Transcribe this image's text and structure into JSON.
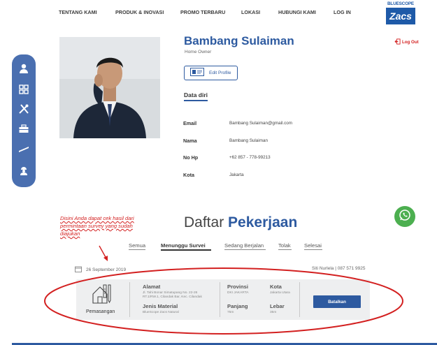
{
  "nav": {
    "items": [
      "TENTANG KAMI",
      "PRODUK & INOVASI",
      "PROMO TERBARU",
      "LOKASI",
      "HUBUNGI KAMI",
      "LOG IN"
    ]
  },
  "logo": {
    "top": "BLUESCOPE",
    "brand": "Zacs"
  },
  "sidebar": {
    "icons": [
      "user-icon",
      "grid-icon",
      "tools-icon",
      "toolbox-icon",
      "roof-icon",
      "worker-icon"
    ]
  },
  "profile": {
    "name": "Bambang Sulaiman",
    "role": "Home Owner",
    "edit_label": "Edit Profile",
    "logout_label": "Log Out",
    "section_title": "Data diri",
    "fields": [
      {
        "label": "Email",
        "value": "Bambang Sulaiman@gmail.com"
      },
      {
        "label": "Nama",
        "value": "Bambang Sulaiman"
      },
      {
        "label": "No Hp",
        "value": "+62 857 - 778-99213"
      },
      {
        "label": "Kota",
        "value": "Jakarta"
      }
    ]
  },
  "annotation": {
    "text": "Disini Anda dapat cek hasil dari permintaan survey yang sudah diajukan"
  },
  "jobs": {
    "title_plain": "Daftar",
    "title_bold": "Pekerjaan",
    "tabs": [
      {
        "label": "Semua",
        "active": false
      },
      {
        "label": "Menunggu Survei",
        "active": true
      },
      {
        "label": "Sedang Berjalan",
        "active": false
      },
      {
        "label": "Tolak",
        "active": false
      },
      {
        "label": "Selesai",
        "active": false
      }
    ],
    "date": "26 September 2019",
    "contact": "Siti Nurlela  |  087 571 9925",
    "card": {
      "category": "Pemasangan",
      "alamat_label": "Alamat",
      "alamat_value": "Jl. Tahi Bonar Simatupang No. 22-26 RT.1/RW.1, Cilandak Bar, Kec. Cilandak",
      "jenis_label": "Jenis Material",
      "jenis_value": "BlueScope Zacs Natural",
      "provinsi_label": "Provinsi",
      "provinsi_value": "DKI JAKARTA",
      "kota_label": "Kota",
      "kota_value": "Jakarta Utara",
      "panjang_label": "Panjang",
      "panjang_value": "75m",
      "lebar_label": "Lebar",
      "lebar_value": "35m",
      "cancel_label": "Batalkan"
    }
  },
  "colors": {
    "accent": "#2d5aa0",
    "sidebar": "#4a6fb0",
    "annotation": "#d32020",
    "whatsapp": "#4caf50"
  }
}
